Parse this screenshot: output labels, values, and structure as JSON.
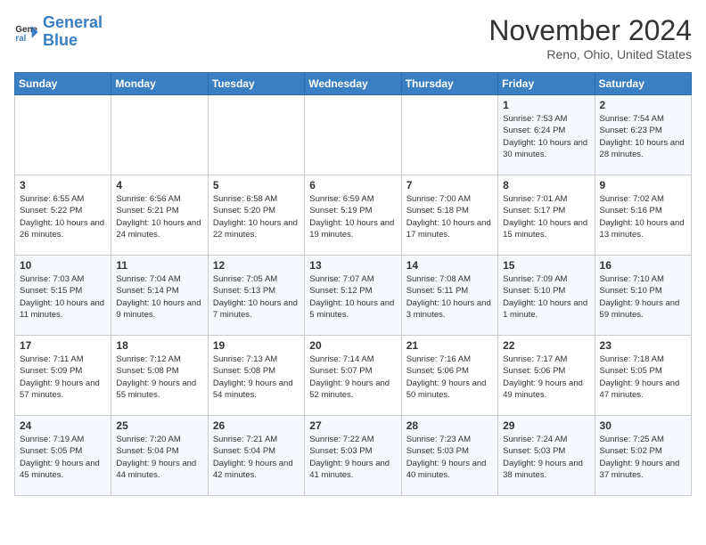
{
  "logo": {
    "line1": "General",
    "line2": "Blue"
  },
  "title": "November 2024",
  "location": "Reno, Ohio, United States",
  "days_header": [
    "Sunday",
    "Monday",
    "Tuesday",
    "Wednesday",
    "Thursday",
    "Friday",
    "Saturday"
  ],
  "weeks": [
    [
      {
        "day": "",
        "detail": ""
      },
      {
        "day": "",
        "detail": ""
      },
      {
        "day": "",
        "detail": ""
      },
      {
        "day": "",
        "detail": ""
      },
      {
        "day": "",
        "detail": ""
      },
      {
        "day": "1",
        "detail": "Sunrise: 7:53 AM\nSunset: 6:24 PM\nDaylight: 10 hours and 30 minutes."
      },
      {
        "day": "2",
        "detail": "Sunrise: 7:54 AM\nSunset: 6:23 PM\nDaylight: 10 hours and 28 minutes."
      }
    ],
    [
      {
        "day": "3",
        "detail": "Sunrise: 6:55 AM\nSunset: 5:22 PM\nDaylight: 10 hours and 26 minutes."
      },
      {
        "day": "4",
        "detail": "Sunrise: 6:56 AM\nSunset: 5:21 PM\nDaylight: 10 hours and 24 minutes."
      },
      {
        "day": "5",
        "detail": "Sunrise: 6:58 AM\nSunset: 5:20 PM\nDaylight: 10 hours and 22 minutes."
      },
      {
        "day": "6",
        "detail": "Sunrise: 6:59 AM\nSunset: 5:19 PM\nDaylight: 10 hours and 19 minutes."
      },
      {
        "day": "7",
        "detail": "Sunrise: 7:00 AM\nSunset: 5:18 PM\nDaylight: 10 hours and 17 minutes."
      },
      {
        "day": "8",
        "detail": "Sunrise: 7:01 AM\nSunset: 5:17 PM\nDaylight: 10 hours and 15 minutes."
      },
      {
        "day": "9",
        "detail": "Sunrise: 7:02 AM\nSunset: 5:16 PM\nDaylight: 10 hours and 13 minutes."
      }
    ],
    [
      {
        "day": "10",
        "detail": "Sunrise: 7:03 AM\nSunset: 5:15 PM\nDaylight: 10 hours and 11 minutes."
      },
      {
        "day": "11",
        "detail": "Sunrise: 7:04 AM\nSunset: 5:14 PM\nDaylight: 10 hours and 9 minutes."
      },
      {
        "day": "12",
        "detail": "Sunrise: 7:05 AM\nSunset: 5:13 PM\nDaylight: 10 hours and 7 minutes."
      },
      {
        "day": "13",
        "detail": "Sunrise: 7:07 AM\nSunset: 5:12 PM\nDaylight: 10 hours and 5 minutes."
      },
      {
        "day": "14",
        "detail": "Sunrise: 7:08 AM\nSunset: 5:11 PM\nDaylight: 10 hours and 3 minutes."
      },
      {
        "day": "15",
        "detail": "Sunrise: 7:09 AM\nSunset: 5:10 PM\nDaylight: 10 hours and 1 minute."
      },
      {
        "day": "16",
        "detail": "Sunrise: 7:10 AM\nSunset: 5:10 PM\nDaylight: 9 hours and 59 minutes."
      }
    ],
    [
      {
        "day": "17",
        "detail": "Sunrise: 7:11 AM\nSunset: 5:09 PM\nDaylight: 9 hours and 57 minutes."
      },
      {
        "day": "18",
        "detail": "Sunrise: 7:12 AM\nSunset: 5:08 PM\nDaylight: 9 hours and 55 minutes."
      },
      {
        "day": "19",
        "detail": "Sunrise: 7:13 AM\nSunset: 5:08 PM\nDaylight: 9 hours and 54 minutes."
      },
      {
        "day": "20",
        "detail": "Sunrise: 7:14 AM\nSunset: 5:07 PM\nDaylight: 9 hours and 52 minutes."
      },
      {
        "day": "21",
        "detail": "Sunrise: 7:16 AM\nSunset: 5:06 PM\nDaylight: 9 hours and 50 minutes."
      },
      {
        "day": "22",
        "detail": "Sunrise: 7:17 AM\nSunset: 5:06 PM\nDaylight: 9 hours and 49 minutes."
      },
      {
        "day": "23",
        "detail": "Sunrise: 7:18 AM\nSunset: 5:05 PM\nDaylight: 9 hours and 47 minutes."
      }
    ],
    [
      {
        "day": "24",
        "detail": "Sunrise: 7:19 AM\nSunset: 5:05 PM\nDaylight: 9 hours and 45 minutes."
      },
      {
        "day": "25",
        "detail": "Sunrise: 7:20 AM\nSunset: 5:04 PM\nDaylight: 9 hours and 44 minutes."
      },
      {
        "day": "26",
        "detail": "Sunrise: 7:21 AM\nSunset: 5:04 PM\nDaylight: 9 hours and 42 minutes."
      },
      {
        "day": "27",
        "detail": "Sunrise: 7:22 AM\nSunset: 5:03 PM\nDaylight: 9 hours and 41 minutes."
      },
      {
        "day": "28",
        "detail": "Sunrise: 7:23 AM\nSunset: 5:03 PM\nDaylight: 9 hours and 40 minutes."
      },
      {
        "day": "29",
        "detail": "Sunrise: 7:24 AM\nSunset: 5:03 PM\nDaylight: 9 hours and 38 minutes."
      },
      {
        "day": "30",
        "detail": "Sunrise: 7:25 AM\nSunset: 5:02 PM\nDaylight: 9 hours and 37 minutes."
      }
    ]
  ]
}
